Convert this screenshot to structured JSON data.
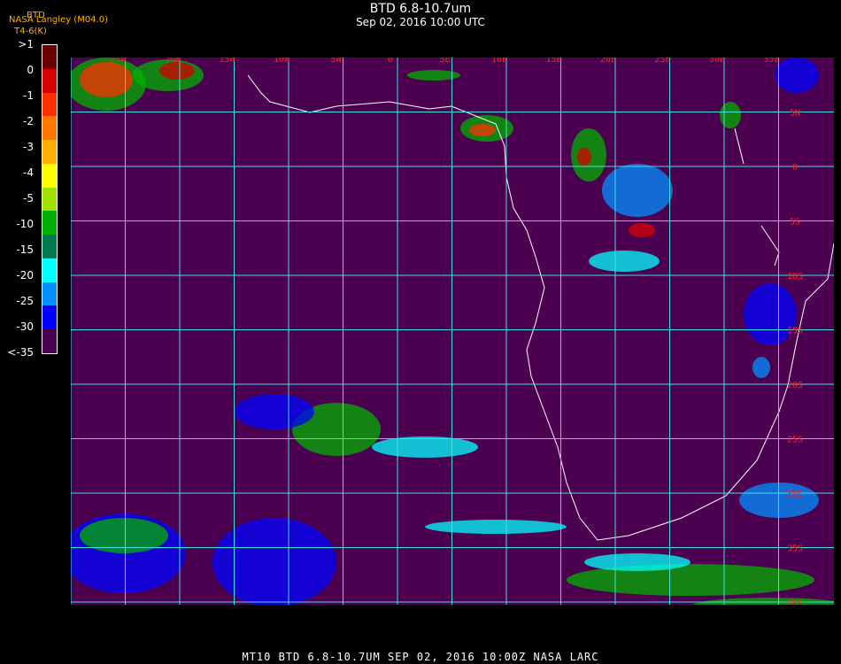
{
  "header": {
    "title": "BTD 6.8-10.7um",
    "subtitle": "Sep 02, 2016 10:00 UTC",
    "source": "NASA Langley (M04.0)",
    "label_btd": "BTD",
    "label_units": "T4-6(K)"
  },
  "colorbar": {
    "labels": [
      ">1",
      "0",
      "-1",
      "-2",
      "-3",
      "-4",
      "-5",
      "-10",
      "-15",
      "-20",
      "-25",
      "-30",
      "<-35"
    ],
    "colors": [
      "#6a0000",
      "#d60000",
      "#ff3000",
      "#ff7800",
      "#ffb000",
      "#ffff00",
      "#a0e000",
      "#00b000",
      "#007850",
      "#00ffff",
      "#0090ff",
      "#0000ff",
      "#4b0050"
    ]
  },
  "map": {
    "background": "#4b0050",
    "grid_color": "#40e0e0",
    "coast_color": "#ffffff",
    "lon_labels": [
      "25W",
      "20W",
      "15W",
      "10W",
      "5W",
      "0",
      "5E",
      "10E",
      "15E",
      "20E",
      "25E",
      "30E",
      "35E"
    ],
    "lat_labels": [
      "5N",
      "0",
      "5S",
      "10S",
      "15S",
      "20S",
      "25S",
      "30S",
      "35S",
      "40S"
    ]
  },
  "footer": {
    "text": "MT10   BTD 6.8-10.7UM   SEP 02, 2016 10:00Z   NASA LARC"
  }
}
